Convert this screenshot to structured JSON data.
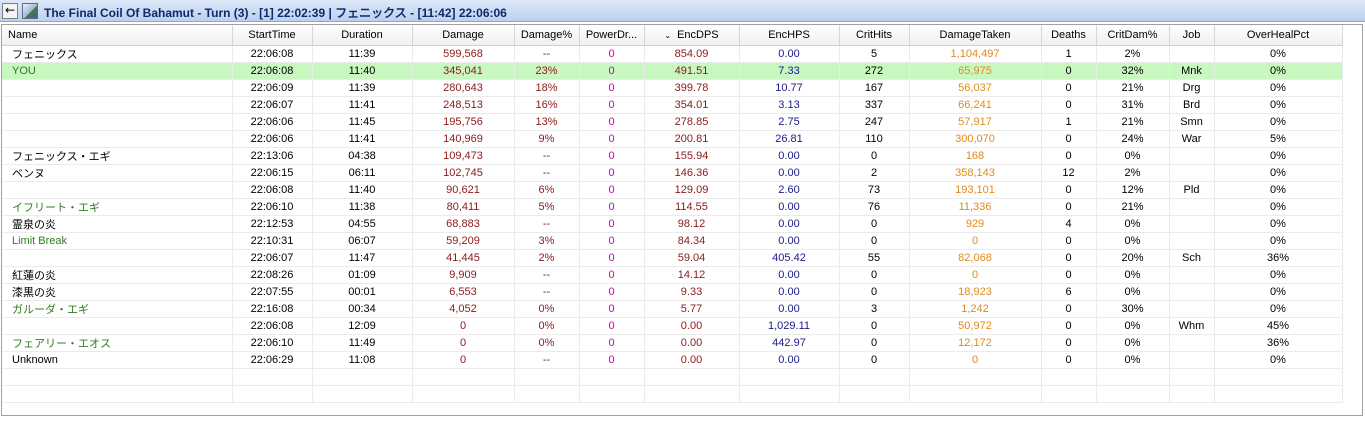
{
  "window": {
    "title": "The Final Coil Of Bahamut - Turn (3) - [1] 22:02:39  | フェニックス - [11:42] 22:06:06"
  },
  "icons": {
    "back": "left-arrow-icon",
    "app": "landscape-icon",
    "sort": "sort-desc-icon"
  },
  "colors": {
    "player_row_highlight": "#c9f7c0",
    "damage": "#8b1a1a",
    "powerdrain": "#c000c0",
    "enchps": "#1a1a8b",
    "damagetaken": "#e08a1e",
    "pet_name": "#2e7d1e"
  },
  "columns": [
    "Name",
    "StartTime",
    "Duration",
    "Damage",
    "Damage%",
    "PowerDr...",
    "EncDPS",
    "EncHPS",
    "CritHits",
    "DamageTaken",
    "Deaths",
    "CritDam%",
    "Job",
    "OverHealPct"
  ],
  "sorted_column": "EncDPS",
  "rows": [
    {
      "name": "フェニックス",
      "start": "22:06:08",
      "dur": "11:39",
      "dmg": "599,568",
      "dmgp": "--",
      "pd": "0",
      "dps": "854.09",
      "hps": "0.00",
      "crit": "5",
      "taken": "1,104,497",
      "deaths": "1",
      "critdam": "2%",
      "job": "",
      "oh": "0%",
      "kind": "enemy",
      "hl": false
    },
    {
      "name": "YOU",
      "start": "22:06:08",
      "dur": "11:40",
      "dmg": "345,041",
      "dmgp": "23%",
      "pd": "0",
      "dps": "491.51",
      "hps": "7.33",
      "crit": "272",
      "taken": "65,975",
      "deaths": "0",
      "critdam": "32%",
      "job": "Mnk",
      "oh": "0%",
      "kind": "ally",
      "hl": true
    },
    {
      "name": "",
      "start": "22:06:09",
      "dur": "11:39",
      "dmg": "280,643",
      "dmgp": "18%",
      "pd": "0",
      "dps": "399.78",
      "hps": "10.77",
      "crit": "167",
      "taken": "56,037",
      "deaths": "0",
      "critdam": "21%",
      "job": "Drg",
      "oh": "0%",
      "kind": "enemy",
      "hl": false
    },
    {
      "name": "",
      "start": "22:06:07",
      "dur": "11:41",
      "dmg": "248,513",
      "dmgp": "16%",
      "pd": "0",
      "dps": "354.01",
      "hps": "3.13",
      "crit": "337",
      "taken": "66,241",
      "deaths": "0",
      "critdam": "31%",
      "job": "Brd",
      "oh": "0%",
      "kind": "enemy",
      "hl": false
    },
    {
      "name": "",
      "start": "22:06:06",
      "dur": "11:45",
      "dmg": "195,756",
      "dmgp": "13%",
      "pd": "0",
      "dps": "278.85",
      "hps": "2.75",
      "crit": "247",
      "taken": "57,917",
      "deaths": "1",
      "critdam": "21%",
      "job": "Smn",
      "oh": "0%",
      "kind": "enemy",
      "hl": false
    },
    {
      "name": "",
      "start": "22:06:06",
      "dur": "11:41",
      "dmg": "140,969",
      "dmgp": "9%",
      "pd": "0",
      "dps": "200.81",
      "hps": "26.81",
      "crit": "110",
      "taken": "300,070",
      "deaths": "0",
      "critdam": "24%",
      "job": "War",
      "oh": "5%",
      "kind": "enemy",
      "hl": false
    },
    {
      "name": "フェニックス・エギ",
      "start": "22:13:06",
      "dur": "04:38",
      "dmg": "109,473",
      "dmgp": "--",
      "pd": "0",
      "dps": "155.94",
      "hps": "0.00",
      "crit": "0",
      "taken": "168",
      "deaths": "0",
      "critdam": "0%",
      "job": "",
      "oh": "0%",
      "kind": "enemy",
      "hl": false
    },
    {
      "name": "ベンヌ",
      "start": "22:06:15",
      "dur": "06:11",
      "dmg": "102,745",
      "dmgp": "--",
      "pd": "0",
      "dps": "146.36",
      "hps": "0.00",
      "crit": "2",
      "taken": "358,143",
      "deaths": "12",
      "critdam": "2%",
      "job": "",
      "oh": "0%",
      "kind": "enemy",
      "hl": false
    },
    {
      "name": "",
      "start": "22:06:08",
      "dur": "11:40",
      "dmg": "90,621",
      "dmgp": "6%",
      "pd": "0",
      "dps": "129.09",
      "hps": "2.60",
      "crit": "73",
      "taken": "193,101",
      "deaths": "0",
      "critdam": "12%",
      "job": "Pld",
      "oh": "0%",
      "kind": "enemy",
      "hl": false
    },
    {
      "name": "イフリート・エギ",
      "start": "22:06:10",
      "dur": "11:38",
      "dmg": "80,411",
      "dmgp": "5%",
      "pd": "0",
      "dps": "114.55",
      "hps": "0.00",
      "crit": "76",
      "taken": "11,336",
      "deaths": "0",
      "critdam": "21%",
      "job": "",
      "oh": "0%",
      "kind": "ally",
      "hl": false
    },
    {
      "name": "霊泉の炎",
      "start": "22:12:53",
      "dur": "04:55",
      "dmg": "68,883",
      "dmgp": "--",
      "pd": "0",
      "dps": "98.12",
      "hps": "0.00",
      "crit": "0",
      "taken": "929",
      "deaths": "4",
      "critdam": "0%",
      "job": "",
      "oh": "0%",
      "kind": "enemy",
      "hl": false
    },
    {
      "name": "Limit Break",
      "start": "22:10:31",
      "dur": "06:07",
      "dmg": "59,209",
      "dmgp": "3%",
      "pd": "0",
      "dps": "84.34",
      "hps": "0.00",
      "crit": "0",
      "taken": "0",
      "deaths": "0",
      "critdam": "0%",
      "job": "",
      "oh": "0%",
      "kind": "ally",
      "hl": false
    },
    {
      "name": "",
      "start": "22:06:07",
      "dur": "11:47",
      "dmg": "41,445",
      "dmgp": "2%",
      "pd": "0",
      "dps": "59.04",
      "hps": "405.42",
      "crit": "55",
      "taken": "82,068",
      "deaths": "0",
      "critdam": "20%",
      "job": "Sch",
      "oh": "36%",
      "kind": "enemy",
      "hl": false
    },
    {
      "name": "紅蓮の炎",
      "start": "22:08:26",
      "dur": "01:09",
      "dmg": "9,909",
      "dmgp": "--",
      "pd": "0",
      "dps": "14.12",
      "hps": "0.00",
      "crit": "0",
      "taken": "0",
      "deaths": "0",
      "critdam": "0%",
      "job": "",
      "oh": "0%",
      "kind": "enemy",
      "hl": false
    },
    {
      "name": "漆黒の炎",
      "start": "22:07:55",
      "dur": "00:01",
      "dmg": "6,553",
      "dmgp": "--",
      "pd": "0",
      "dps": "9.33",
      "hps": "0.00",
      "crit": "0",
      "taken": "18,923",
      "deaths": "6",
      "critdam": "0%",
      "job": "",
      "oh": "0%",
      "kind": "enemy",
      "hl": false
    },
    {
      "name": "ガルーダ・エギ",
      "start": "22:16:08",
      "dur": "00:34",
      "dmg": "4,052",
      "dmgp": "0%",
      "pd": "0",
      "dps": "5.77",
      "hps": "0.00",
      "crit": "3",
      "taken": "1,242",
      "deaths": "0",
      "critdam": "30%",
      "job": "",
      "oh": "0%",
      "kind": "ally",
      "hl": false
    },
    {
      "name": "",
      "start": "22:06:08",
      "dur": "12:09",
      "dmg": "0",
      "dmgp": "0%",
      "pd": "0",
      "dps": "0.00",
      "hps": "1,029.11",
      "crit": "0",
      "taken": "50,972",
      "deaths": "0",
      "critdam": "0%",
      "job": "Whm",
      "oh": "45%",
      "kind": "enemy",
      "hl": false
    },
    {
      "name": "フェアリー・エオス",
      "start": "22:06:10",
      "dur": "11:49",
      "dmg": "0",
      "dmgp": "0%",
      "pd": "0",
      "dps": "0.00",
      "hps": "442.97",
      "crit": "0",
      "taken": "12,172",
      "deaths": "0",
      "critdam": "0%",
      "job": "",
      "oh": "36%",
      "kind": "ally",
      "hl": false
    },
    {
      "name": "Unknown",
      "start": "22:06:29",
      "dur": "11:08",
      "dmg": "0",
      "dmgp": "--",
      "pd": "0",
      "dps": "0.00",
      "hps": "0.00",
      "crit": "0",
      "taken": "0",
      "deaths": "0",
      "critdam": "0%",
      "job": "",
      "oh": "0%",
      "kind": "enemy",
      "hl": false
    }
  ]
}
